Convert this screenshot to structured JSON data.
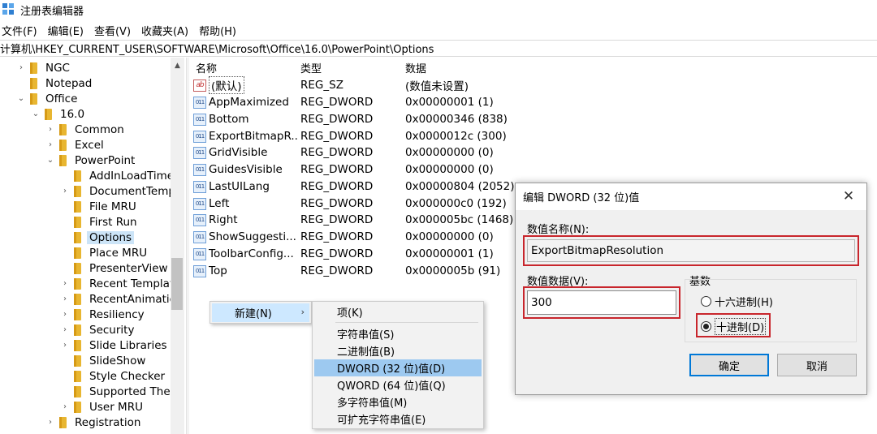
{
  "window": {
    "title": "注册表编辑器"
  },
  "menubar": [
    "文件(F)",
    "编辑(E)",
    "查看(V)",
    "收藏夹(A)",
    "帮助(H)"
  ],
  "address": "计算机\\HKEY_CURRENT_USER\\SOFTWARE\\Microsoft\\Office\\16.0\\PowerPoint\\Options",
  "tree": {
    "items": [
      {
        "label": "NGC"
      },
      {
        "label": "Notepad"
      },
      {
        "label": "Office"
      },
      {
        "label": "16.0"
      },
      {
        "label": "Common"
      },
      {
        "label": "Excel"
      },
      {
        "label": "PowerPoint"
      },
      {
        "label": "AddInLoadTime"
      },
      {
        "label": "DocumentTemp"
      },
      {
        "label": "File MRU"
      },
      {
        "label": "First Run"
      },
      {
        "label": "Options"
      },
      {
        "label": "Place MRU"
      },
      {
        "label": "PresenterView"
      },
      {
        "label": "Recent Templat"
      },
      {
        "label": "RecentAnimatio"
      },
      {
        "label": "Resiliency"
      },
      {
        "label": "Security"
      },
      {
        "label": "Slide Libraries"
      },
      {
        "label": "SlideShow"
      },
      {
        "label": "Style Checker"
      },
      {
        "label": "Supported Ther"
      },
      {
        "label": "User MRU"
      },
      {
        "label": "Registration"
      }
    ]
  },
  "values": {
    "headers": {
      "name": "名称",
      "type": "类型",
      "data": "数据"
    },
    "rows": [
      {
        "name": "(默认)",
        "type": "REG_SZ",
        "data": "(数值未设置)",
        "icon": "string-value-icon"
      },
      {
        "name": "AppMaximized",
        "type": "REG_DWORD",
        "data": "0x00000001 (1)",
        "icon": "binary-value-icon"
      },
      {
        "name": "Bottom",
        "type": "REG_DWORD",
        "data": "0x00000346 (838)",
        "icon": "binary-value-icon"
      },
      {
        "name": "ExportBitmapR...",
        "type": "REG_DWORD",
        "data": "0x0000012c (300)",
        "icon": "binary-value-icon"
      },
      {
        "name": "GridVisible",
        "type": "REG_DWORD",
        "data": "0x00000000 (0)",
        "icon": "binary-value-icon"
      },
      {
        "name": "GuidesVisible",
        "type": "REG_DWORD",
        "data": "0x00000000 (0)",
        "icon": "binary-value-icon"
      },
      {
        "name": "LastUILang",
        "type": "REG_DWORD",
        "data": "0x00000804 (2052)",
        "icon": "binary-value-icon"
      },
      {
        "name": "Left",
        "type": "REG_DWORD",
        "data": "0x000000c0 (192)",
        "icon": "binary-value-icon"
      },
      {
        "name": "Right",
        "type": "REG_DWORD",
        "data": "0x000005bc (1468)",
        "icon": "binary-value-icon"
      },
      {
        "name": "ShowSuggesti...",
        "type": "REG_DWORD",
        "data": "0x00000000 (0)",
        "icon": "binary-value-icon"
      },
      {
        "name": "ToolbarConfig...",
        "type": "REG_DWORD",
        "data": "0x00000001 (1)",
        "icon": "binary-value-icon"
      },
      {
        "name": "Top",
        "type": "REG_DWORD",
        "data": "0x0000005b (91)",
        "icon": "binary-value-icon"
      }
    ]
  },
  "context_menu": {
    "new_label": "新建(N)",
    "submenu": [
      "项(K)",
      "字符串值(S)",
      "二进制值(B)",
      "DWORD (32 位)值(D)",
      "QWORD (64 位)值(Q)",
      "多字符串值(M)",
      "可扩充字符串值(E)"
    ],
    "highlighted": "DWORD (32 位)值(D)"
  },
  "dialog": {
    "title": "编辑 DWORD (32 位)值",
    "name_label": "数值名称(N):",
    "name_value": "ExportBitmapResolution",
    "data_label": "数值数据(V):",
    "data_value": "300",
    "base_label": "基数",
    "hex_label": "十六进制(H)",
    "dec_label": "十进制(D)",
    "selected_base": "十进制(D)",
    "ok_label": "确定",
    "cancel_label": "取消"
  },
  "colors": {
    "highlight_box": "#c8252c",
    "menu_highlight": "#9dc9f0",
    "folder": "#e8b631"
  }
}
